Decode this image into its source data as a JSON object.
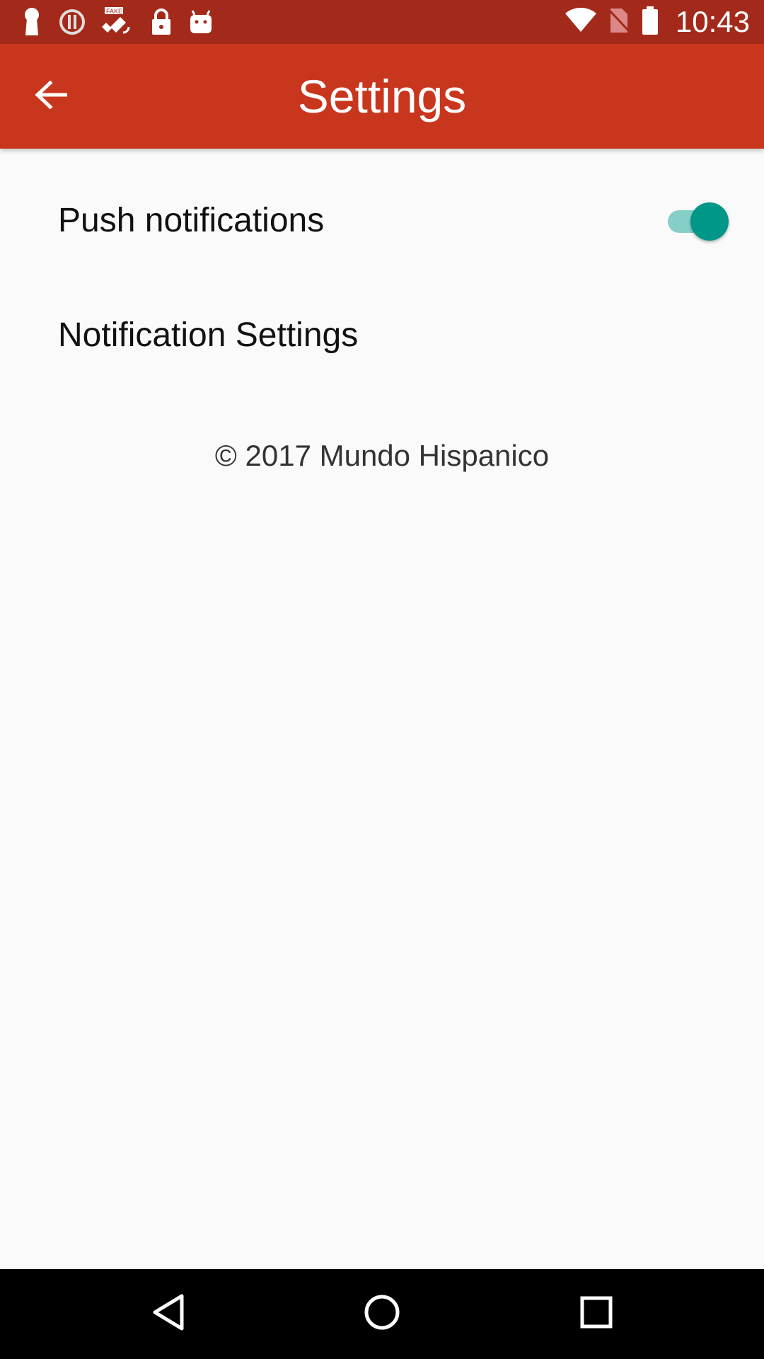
{
  "status_bar": {
    "time": "10:43",
    "background_color": "#a32a1a",
    "icons_left": [
      "keyhole-notification-icon",
      "alert-notification-icon",
      "fake-gps-satellite-icon",
      "lock-icon",
      "android-robot-icon"
    ],
    "icons_right": [
      "wifi-icon",
      "no-sim-icon",
      "battery-icon"
    ]
  },
  "app_bar": {
    "title": "Settings",
    "background_color": "#c9361e",
    "back_icon": "arrow-left-icon"
  },
  "settings": {
    "push_notifications": {
      "label": "Push notifications",
      "enabled": true,
      "accent_color": "#009688"
    },
    "notification_settings": {
      "label": "Notification Settings"
    }
  },
  "footer": {
    "copyright": "© 2017 Mundo Hispanico"
  },
  "nav_bar": {
    "buttons": [
      "back-triangle-icon",
      "home-circle-icon",
      "recents-square-icon"
    ]
  }
}
